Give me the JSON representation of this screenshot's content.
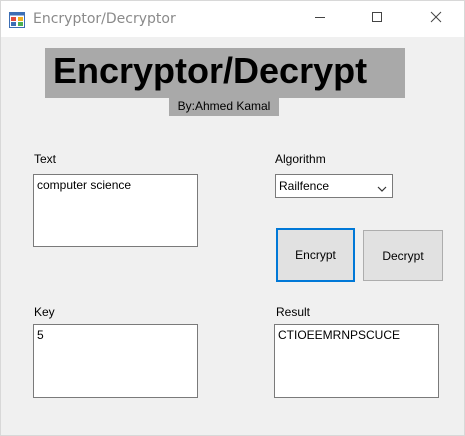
{
  "window": {
    "title": "Encryptor/Decryptor",
    "app_icon": "windows-form-icon",
    "controls": {
      "minimize_icon": "minimize-icon",
      "maximize_icon": "maximize-icon",
      "close_icon": "close-icon"
    }
  },
  "header": {
    "title": "Encryptor/Decrypt",
    "author": "By:Ahmed Kamal"
  },
  "text_section": {
    "label": "Text",
    "value": "computer science"
  },
  "algorithm": {
    "label": "Algorithm",
    "selected": "Railfence",
    "dropdown_icon": "chevron-down-icon"
  },
  "buttons": {
    "encrypt": "Encrypt",
    "decrypt": "Decrypt"
  },
  "key_section": {
    "label": "Key",
    "value": "5"
  },
  "result_section": {
    "label": "Result",
    "value": "CTIOEEMRNPSCUCE"
  },
  "colors": {
    "banner": "#a9a9a9",
    "focus": "#0078d7",
    "background": "#f0f0f0"
  }
}
